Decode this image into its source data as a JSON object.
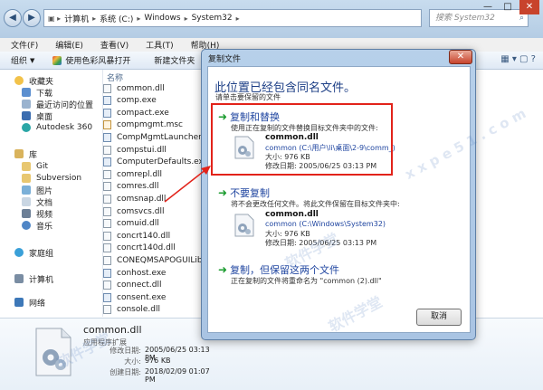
{
  "explorer": {
    "address": [
      "计算机",
      "系统 (C:)",
      "Windows",
      "System32"
    ],
    "search_placeholder": "搜索 System32",
    "menu": [
      "文件(F)",
      "编辑(E)",
      "查看(V)",
      "工具(T)",
      "帮助(H)"
    ],
    "toolbar": [
      "组织",
      "使用色彩风暴打开",
      "新建文件夹"
    ],
    "sidebar": {
      "favorites": "收藏夹",
      "fav_items": [
        "下载",
        "最近访问的位置",
        "桌面",
        "Autodesk 360"
      ],
      "library": "库",
      "lib_items": [
        "Git",
        "Subversion",
        "图片",
        "文档",
        "视频",
        "音乐"
      ],
      "homegroup": "家庭组",
      "computer": "计算机",
      "network": "网络"
    },
    "file_header": "名称",
    "files": [
      {
        "name": "common.dll",
        "kind": "dll"
      },
      {
        "name": "comp.exe",
        "kind": "exe"
      },
      {
        "name": "compact.exe",
        "kind": "exe"
      },
      {
        "name": "compmgmt.msc",
        "kind": "msc"
      },
      {
        "name": "CompMgmtLauncher.exe",
        "kind": "exe"
      },
      {
        "name": "compstui.dll",
        "kind": "dll"
      },
      {
        "name": "ComputerDefaults.exe",
        "kind": "exe"
      },
      {
        "name": "comrepl.dll",
        "kind": "dll"
      },
      {
        "name": "comres.dll",
        "kind": "dll"
      },
      {
        "name": "comsnap.dll",
        "kind": "dll"
      },
      {
        "name": "comsvcs.dll",
        "kind": "dll"
      },
      {
        "name": "comuid.dll",
        "kind": "dll"
      },
      {
        "name": "concrt140.dll",
        "kind": "dll"
      },
      {
        "name": "concrt140d.dll",
        "kind": "dll"
      },
      {
        "name": "CONEQMSAPOGUILibrary",
        "kind": "dll"
      },
      {
        "name": "conhost.exe",
        "kind": "exe"
      },
      {
        "name": "connect.dll",
        "kind": "dll"
      },
      {
        "name": "consent.exe",
        "kind": "exe"
      },
      {
        "name": "console.dll",
        "kind": "dll"
      }
    ],
    "details": {
      "name": "common.dll",
      "type": "应用程序扩展",
      "rows": [
        {
          "label": "修改日期:",
          "value": "2005/06/25 03:13 PM"
        },
        {
          "label": "大小:",
          "value": "976 KB"
        },
        {
          "label": "创建日期:",
          "value": "2018/02/09 01:07 PM"
        }
      ]
    }
  },
  "dialog": {
    "title": "复制文件",
    "heading": "此位置已经包含同名文件。",
    "subheading": "请单击要保留的文件",
    "opt1": {
      "title": "复制和替换",
      "desc": "使用正在复制的文件替换目标文件夹中的文件:",
      "file": "common.dll",
      "path": "common (C:\\用户\\li\\桌面\\2-9\\comm_)",
      "size": "大小: 976 KB",
      "date": "修改日期: 2005/06/25 03:13 PM"
    },
    "opt2": {
      "title": "不要复制",
      "desc": "将不会更改任何文件。将此文件保留在目标文件夹中:",
      "file": "common.dll",
      "path": "common (C:\\Windows\\System32)",
      "size": "大小: 976 KB",
      "date": "修改日期: 2005/06/25 03:13 PM"
    },
    "opt3": {
      "title": "复制，但保留这两个文件",
      "desc": "正在复制的文件将重命名为 \"common (2).dll\""
    },
    "cancel": "取消",
    "close_glyph": "✕"
  },
  "watermark": [
    "软件学堂",
    "x x p e 5 1 . c o m"
  ],
  "colors": {
    "accent_link": "#1f45a0",
    "highlight_red": "#e2231a",
    "arrow_green": "#1a9b2e"
  }
}
